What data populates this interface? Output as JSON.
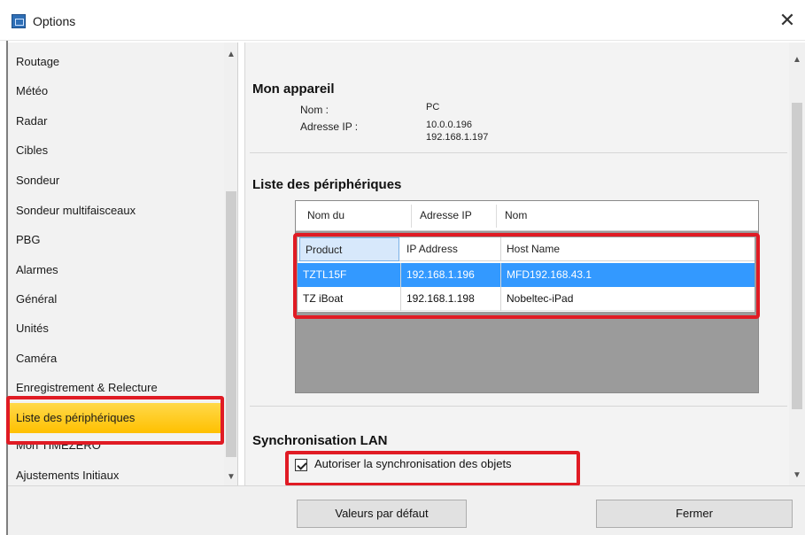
{
  "window": {
    "title": "Options",
    "close_glyph": "✕"
  },
  "sidebar": {
    "items": [
      {
        "label": "Routage"
      },
      {
        "label": "Météo"
      },
      {
        "label": "Radar"
      },
      {
        "label": "Cibles"
      },
      {
        "label": "Sondeur"
      },
      {
        "label": "Sondeur multifaisceaux"
      },
      {
        "label": "PBG"
      },
      {
        "label": "Alarmes"
      },
      {
        "label": "Général"
      },
      {
        "label": "Unités"
      },
      {
        "label": "Caméra"
      },
      {
        "label": "Enregistrement & Relecture"
      },
      {
        "label": "Liste des périphériques",
        "selected": true
      },
      {
        "label": "Mon TIMEZERO"
      },
      {
        "label": "Ajustements Initiaux"
      }
    ]
  },
  "my_device": {
    "title": "Mon appareil",
    "name_label": "Nom :",
    "name_value": "PC",
    "ip_label": "Adresse IP :",
    "ip_value_1": "10.0.0.196",
    "ip_value_2": "192.168.1.197"
  },
  "device_list": {
    "title": "Liste des périphériques",
    "columns": [
      "Nom du",
      "Adresse IP",
      "Nom"
    ],
    "inner_columns": [
      "Product",
      "IP Address",
      "Host Name"
    ],
    "rows": [
      {
        "product": "TZTL15F",
        "ip": "192.168.1.196",
        "host": "MFD192.168.43.1",
        "selected": true
      },
      {
        "product": "TZ iBoat",
        "ip": "192.168.1.198",
        "host": "Nobeltec-iPad",
        "selected": false
      }
    ]
  },
  "lan_sync": {
    "title": "Synchronisation LAN",
    "checkbox_label": "Autoriser la synchronisation des objets",
    "checked": true
  },
  "buttons": {
    "defaults": "Valeurs par défaut",
    "close": "Fermer"
  },
  "colors": {
    "highlight": "#e01b24",
    "selection": "#3399ff",
    "sidebar_selected": "#ffc000"
  }
}
